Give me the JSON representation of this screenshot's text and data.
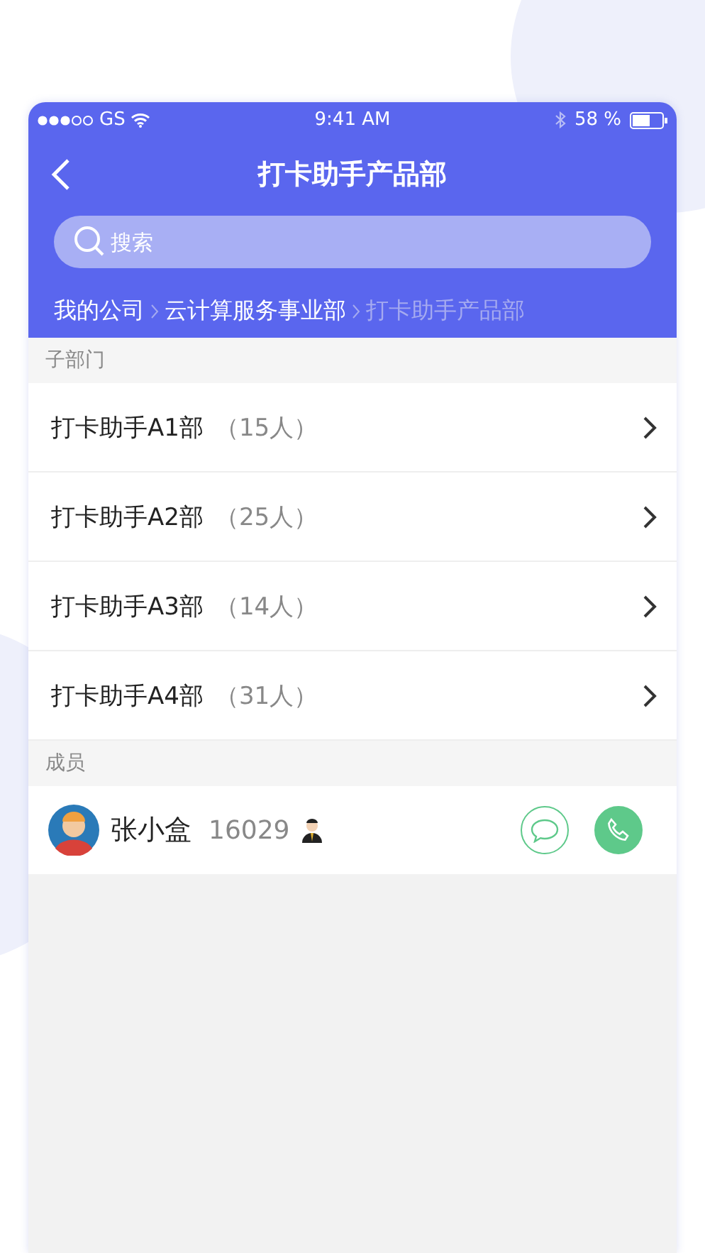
{
  "status_bar": {
    "carrier": "GS",
    "time": "9:41 AM",
    "battery": "58 %"
  },
  "nav": {
    "title": "打卡助手产品部"
  },
  "search": {
    "placeholder": "搜索"
  },
  "breadcrumb": [
    {
      "label": "我的公司",
      "selected": false
    },
    {
      "label": "云计算服务事业部",
      "selected": false
    },
    {
      "label": "打卡助手产品部",
      "selected": true
    }
  ],
  "departments": {
    "heading": "子部门",
    "items": [
      {
        "name": "打卡助手A1部",
        "count": "（15人）"
      },
      {
        "name": "打卡助手A2部",
        "count": "（25人）"
      },
      {
        "name": "打卡助手A3部",
        "count": "（14人）"
      },
      {
        "name": "打卡助手A4部",
        "count": "（31人）"
      }
    ]
  },
  "members": {
    "heading": "成员",
    "items": [
      {
        "name": "张小盒",
        "id": "16029"
      }
    ]
  }
}
